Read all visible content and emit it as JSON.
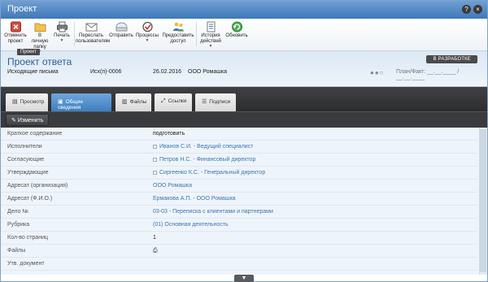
{
  "window": {
    "title": "Проект"
  },
  "toolbar": {
    "buttons": [
      {
        "label_1": "Отменить",
        "label_2": "проект",
        "icon": "cancel-icon"
      },
      {
        "label_1": "В личную",
        "label_2": "папку",
        "icon": "folder-icon"
      },
      {
        "label_1": "Печать",
        "label_2": "",
        "icon": "print-icon"
      },
      {
        "label_1": "Переслать",
        "label_2": "пользователям",
        "icon": "forward-icon"
      },
      {
        "label_1": "Отправить",
        "label_2": "",
        "icon": "send-icon"
      },
      {
        "label_1": "Процессы",
        "label_2": "",
        "icon": "processes-icon"
      },
      {
        "label_1": "Предоставить",
        "label_2": "доступ",
        "icon": "share-access-icon"
      },
      {
        "label_1": "История",
        "label_2": "действий",
        "icon": "history-icon"
      },
      {
        "label_1": "Обновить",
        "label_2": "",
        "icon": "refresh-icon"
      }
    ],
    "tooltip": "Проект"
  },
  "header": {
    "title": "Проект ответа",
    "status": "В РАЗРАБОТКЕ",
    "doc_type": "Исходящие письма",
    "doc_number": "Исх(п)-0006",
    "date": "26.02.2016",
    "organization": "ООО Ромашка",
    "dots": "●●○",
    "plan_fact": "План/Факт: __.__.____ / __.__.____"
  },
  "tabs": [
    {
      "label": "Просмотр",
      "icon": "view-icon",
      "active": false
    },
    {
      "label": "Общие сведения",
      "icon": "info-icon",
      "active": true
    },
    {
      "label": "Файлы",
      "icon": "files-icon",
      "active": false
    },
    {
      "label": "Ссылки",
      "icon": "links-icon",
      "active": false
    },
    {
      "label": "Подписи",
      "icon": "signatures-icon",
      "active": false
    }
  ],
  "actions": {
    "edit_label": "Изменить"
  },
  "fields": [
    {
      "label": "Краткое содержание",
      "value": "подготовить",
      "link": false,
      "check": false
    },
    {
      "label": "Исполнители",
      "value": "Иванов С.И. - Ведущий специалист",
      "link": true,
      "check": true
    },
    {
      "label": "Согласующие",
      "value": "Петров Н.С. - Финансовый директор",
      "link": true,
      "check": true
    },
    {
      "label": "Утверждающие",
      "value": "Сиргеенко К.С. - Генеральный директор",
      "link": true,
      "check": true
    },
    {
      "label": "Адресат (организация)",
      "value": "ООО Ромашка",
      "link": true,
      "check": false
    },
    {
      "label": "Адресат (Ф.И.О.)",
      "value": "Ермакова А.П. - ООО Ромашка",
      "link": true,
      "check": false
    },
    {
      "label": "Дело №",
      "value": "03-03 - Переписка с клиентами и партнерами",
      "link": true,
      "check": false
    },
    {
      "label": "Рубрика",
      "value": "(01) Основная деятельность",
      "link": true,
      "check": false
    },
    {
      "label": "Кол-во страниц",
      "value": "1",
      "link": false,
      "check": false
    },
    {
      "label": "Файлы",
      "value": "⎙",
      "link": false,
      "check": false
    },
    {
      "label": "Утв. документ",
      "value": "",
      "link": false,
      "check": false
    }
  ],
  "colors": {
    "accent": "#3d7fc0",
    "title_bar": "#4a7fbe",
    "link": "#3b76b3",
    "dark_bar": "#2c2d2f"
  }
}
